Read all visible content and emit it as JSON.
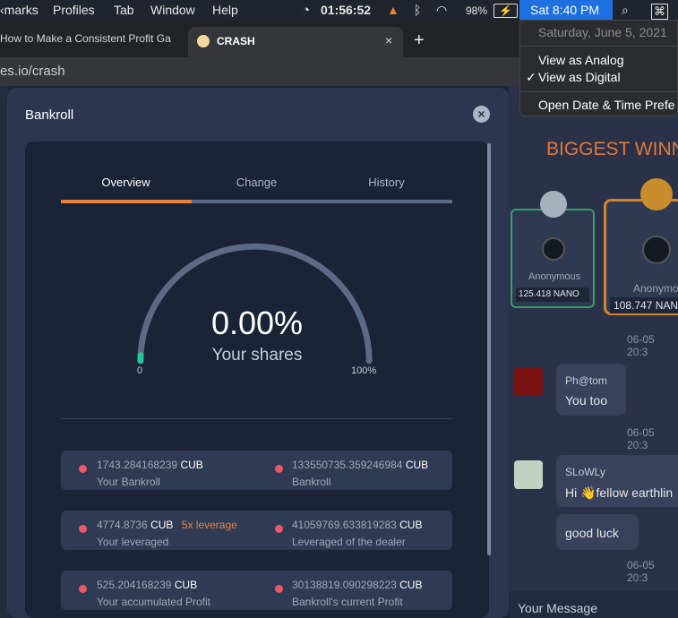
{
  "menubar": {
    "items": [
      "‹marks",
      "Profiles",
      "Tab",
      "Window",
      "Help"
    ],
    "timer": "01:56:52",
    "battery": "98%",
    "datetime": "Sat 8:40 PM"
  },
  "dropdown": {
    "date": "Saturday, June 5, 2021",
    "analog": "View as Analog",
    "digital": "View as Digital",
    "checkmark": "✓",
    "prefs": "Open Date & Time Prefe"
  },
  "browser": {
    "tab1": "How to Make a Consistent Profit Ga",
    "tab2": "CRASH",
    "close": "×",
    "newtab": "+",
    "url": "es.io/crash"
  },
  "modal": {
    "title": "Bankroll",
    "close": "×",
    "tabs": [
      "Overview",
      "Change",
      "History"
    ],
    "percent": "0.00%",
    "shares_label": "Your shares",
    "gauge_min": "0",
    "gauge_max": "100%",
    "gauge_level": 0.0,
    "stats": [
      [
        {
          "value": "1743.284168239",
          "unit": "CUB",
          "label": "Your Bankroll"
        },
        {
          "value": "133550735.359246984",
          "unit": "CUB",
          "label": "Bankroll"
        }
      ],
      [
        {
          "value": "4774.8736",
          "unit": "CUB",
          "extra": "5x leverage",
          "label": "Your leveraged"
        },
        {
          "value": "41059769.633819283",
          "unit": "CUB",
          "label": "Leveraged of the dealer"
        }
      ],
      [
        {
          "value": "525.204168239",
          "unit": "CUB",
          "label": "Your accumulated Profit"
        },
        {
          "value": "30138819.090298223",
          "unit": "CUB",
          "label": "Bankroll's current Profit"
        }
      ]
    ]
  },
  "right": {
    "biggest": "BIGGEST WINN",
    "winner2": {
      "rank": "2",
      "name": "Anonymous",
      "amount": "125.418 NANO"
    },
    "winner1": {
      "rank": "1",
      "name": "Anonymous",
      "amount": "108.747 NANO"
    },
    "chat": [
      {
        "user": "Ph@tom",
        "text": "You too",
        "time": "06-05 20:3"
      },
      {
        "user": "SLoWLy",
        "text": "Hi 👋fellow earthlin",
        "time": "06-05 20:3"
      },
      {
        "user": "",
        "text": "good luck",
        "time": "06-05 20:3"
      }
    ],
    "partial_time": "06-05 20:3",
    "my_message": "Your Message"
  },
  "colors": {
    "accent": "#e8823a",
    "dot": "#f0566a",
    "gauge_track": "#5d6a85",
    "gauge_fill": "#20c997"
  }
}
